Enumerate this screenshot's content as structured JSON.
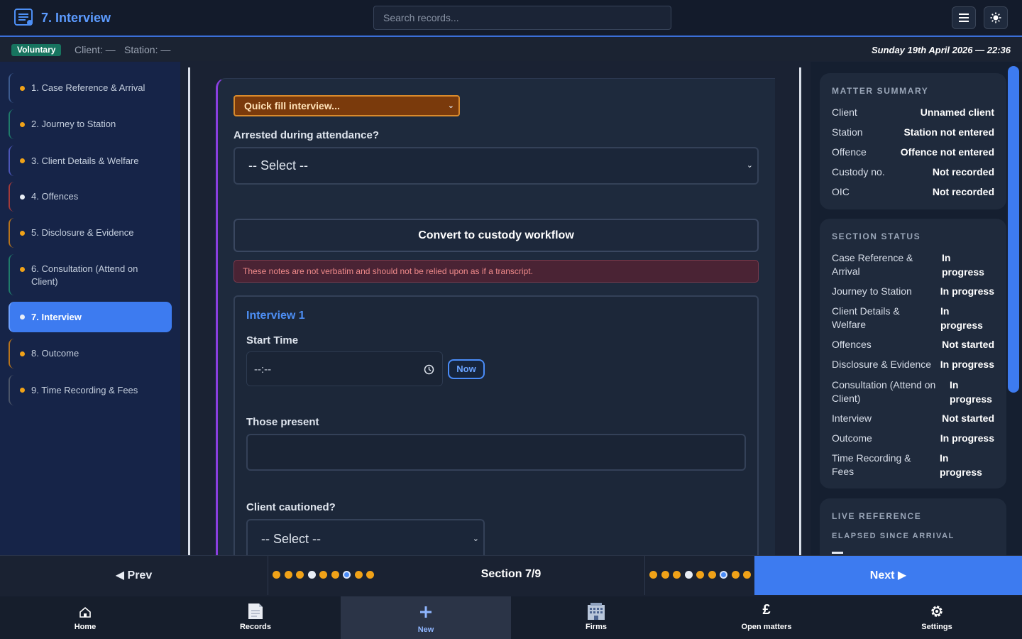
{
  "header": {
    "title": "7. Interview",
    "search_placeholder": "Search records...",
    "menu_icon": "hamburger-icon",
    "theme_icon": "sun-icon"
  },
  "subbar": {
    "badge": "Voluntary",
    "client_label": "Client: —",
    "station_label": "Station: —",
    "date": "Sunday 19th April 2026 — 22:36"
  },
  "sidebar": {
    "items": [
      {
        "label": "1. Case Reference & Arrival"
      },
      {
        "label": "2. Journey to Station"
      },
      {
        "label": "3. Client Details & Welfare"
      },
      {
        "label": "4. Offences"
      },
      {
        "label": "5. Disclosure & Evidence"
      },
      {
        "label": "6. Consultation (Attend on Client)"
      },
      {
        "label": "7. Interview"
      },
      {
        "label": "8. Outcome"
      },
      {
        "label": "9. Time Recording & Fees"
      }
    ]
  },
  "form": {
    "quickfill": "Quick fill interview...",
    "arrested_label": "Arrested during attendance?",
    "arrested_value": "-- Select --",
    "convert_button": "Convert to custody workflow",
    "warning": "These notes are not verbatim and should not be relied upon as if a transcript.",
    "interview_title": "Interview 1",
    "start_time_label": "Start Time",
    "start_time_value": "--:--",
    "now_button": "Now",
    "present_label": "Those present",
    "cautioned_label": "Client cautioned?",
    "cautioned_value": "-- Select --"
  },
  "matter_summary": {
    "heading": "MATTER SUMMARY",
    "rows": [
      {
        "key": "Client",
        "value": "Unnamed client"
      },
      {
        "key": "Station",
        "value": "Station not entered"
      },
      {
        "key": "Offence",
        "value": "Offence not entered"
      },
      {
        "key": "Custody no.",
        "value": "Not recorded"
      },
      {
        "key": "OIC",
        "value": "Not recorded"
      }
    ]
  },
  "section_status": {
    "heading": "SECTION STATUS",
    "rows": [
      {
        "key": "Case Reference & Arrival",
        "value": "In progress"
      },
      {
        "key": "Journey to Station",
        "value": "In progress"
      },
      {
        "key": "Client Details & Welfare",
        "value": "In progress"
      },
      {
        "key": "Offences",
        "value": "Not started"
      },
      {
        "key": "Disclosure & Evidence",
        "value": "In progress"
      },
      {
        "key": "Consultation (Attend on Client)",
        "value": "In progress"
      },
      {
        "key": "Interview",
        "value": "Not started"
      },
      {
        "key": "Outcome",
        "value": "In progress"
      },
      {
        "key": "Time Recording & Fees",
        "value": "In progress"
      }
    ]
  },
  "live_reference": {
    "heading": "LIVE REFERENCE",
    "subheading": "ELAPSED SINCE ARRIVAL"
  },
  "footer_nav": {
    "prev": "◀ Prev",
    "next": "Next ▶",
    "section": "Section 7/9",
    "current_section": 7,
    "total_sections": 9
  },
  "tabs": [
    {
      "label": "Home",
      "icon": "home-icon"
    },
    {
      "label": "Records",
      "icon": "document-icon"
    },
    {
      "label": "New",
      "icon": "plus-icon"
    },
    {
      "label": "Firms",
      "icon": "building-icon"
    },
    {
      "label": "Open matters",
      "icon": "pound-icon"
    },
    {
      "label": "Settings",
      "icon": "gear-icon"
    }
  ],
  "colors": {
    "accent": "#3d7bf0",
    "status_dot": "#f0a218",
    "badge": "#17745f",
    "quickfill": "#7a3a0c"
  }
}
